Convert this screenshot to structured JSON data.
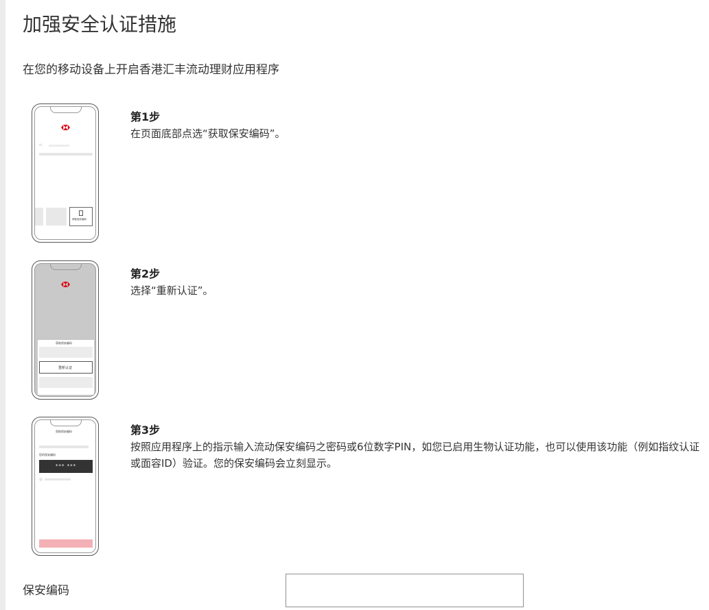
{
  "header": {
    "title": "加强安全认证措施",
    "subtitle": "在您的移动设备上开启香港汇丰流动理财应用程序"
  },
  "steps": [
    {
      "heading": "第1步",
      "description": "在页面底部点选“获取保安编码”。",
      "phone": {
        "get_code_label": "获取保安编码",
        "field_hint": "Hi,"
      }
    },
    {
      "heading": "第2步",
      "description": "选择“重新认证”。",
      "phone": {
        "sheet_title": "获取保安编码",
        "reauth_label": "重新认证"
      }
    },
    {
      "heading": "第3步",
      "description": "按照应用程序上的指示输入流动保安编码之密码或6位数字PIN，如您已启用生物认证功能，也可以使用该功能（例如指纹认证或面容ID）验证。您的保安编码会立刻显示。",
      "phone": {
        "screen_title": "获取保安编码",
        "code_label": "您的保安编码",
        "code_masked": "*** ***"
      }
    }
  ],
  "form": {
    "security_code_label": "保安编码",
    "security_code_value": ""
  },
  "colors": {
    "brand_red": "#db0011",
    "accent_pink": "#f4b1b5",
    "dark_box": "#333333"
  }
}
